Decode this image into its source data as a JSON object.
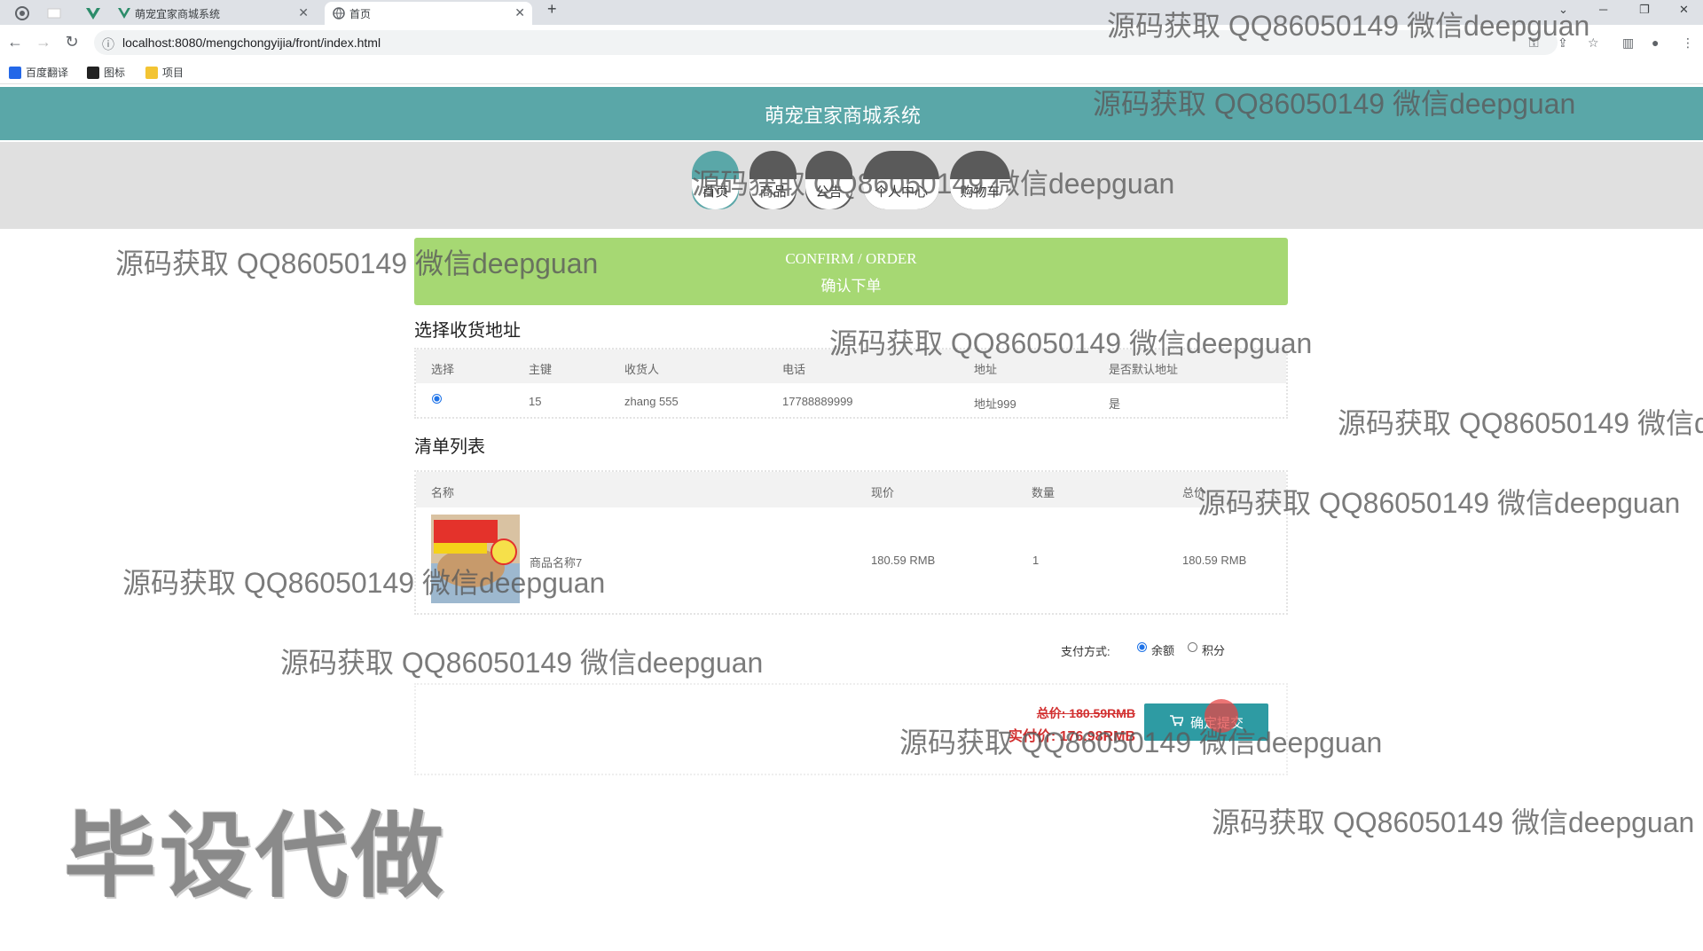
{
  "browser": {
    "tabs": [
      {
        "title": "萌宠宜家商城系统",
        "active": false
      },
      {
        "title": "首页",
        "active": true
      }
    ],
    "new_tab_label": "+",
    "url": "localhost:8080/mengchongyijia/front/index.html",
    "bookmarks": [
      {
        "label": "百度翻译",
        "icon": "translate-icon"
      },
      {
        "label": "图标",
        "icon": "image-icon"
      },
      {
        "label": "项目",
        "icon": "folder-icon"
      }
    ]
  },
  "site": {
    "title": "萌宠宜家商城系统",
    "nav": [
      "首页",
      "商品",
      "公告",
      "个人中心",
      "购物车"
    ],
    "nav_active_index": 0
  },
  "order": {
    "banner_en": "CONFIRM / ORDER",
    "banner_cn": "确认下单",
    "address_section": "选择收货地址",
    "address_table": {
      "headers": [
        "选择",
        "主键",
        "收货人",
        "电话",
        "地址",
        "是否默认地址"
      ],
      "rows": [
        {
          "selected": true,
          "id": "15",
          "name": "zhang 555",
          "phone": "17788889999",
          "address": "地址999",
          "default": "是"
        }
      ]
    },
    "items_section": "清单列表",
    "items_table": {
      "headers": [
        "名称",
        "现价",
        "数量",
        "总价"
      ],
      "rows": [
        {
          "name": "商品名称7",
          "price": "180.59 RMB",
          "qty": "1",
          "total": "180.59 RMB"
        }
      ]
    },
    "payment": {
      "label": "支付方式:",
      "options": [
        {
          "label": "余额",
          "selected": true
        },
        {
          "label": "积分",
          "selected": false
        }
      ]
    },
    "total_label": "总价: 180.59RMB",
    "paid_label": "实付价: 176.98RMB",
    "submit_label": "确定提交"
  },
  "watermark": {
    "text": "源码获取 QQ86050149 微信deepguan",
    "text_clipped": "源码获取 QQ86050149 微信d",
    "big": "毕设代做"
  },
  "colors": {
    "header": "#5aa7a8",
    "banner": "#a6d873",
    "submit": "#2e9ba3",
    "price_red": "#d23030"
  }
}
